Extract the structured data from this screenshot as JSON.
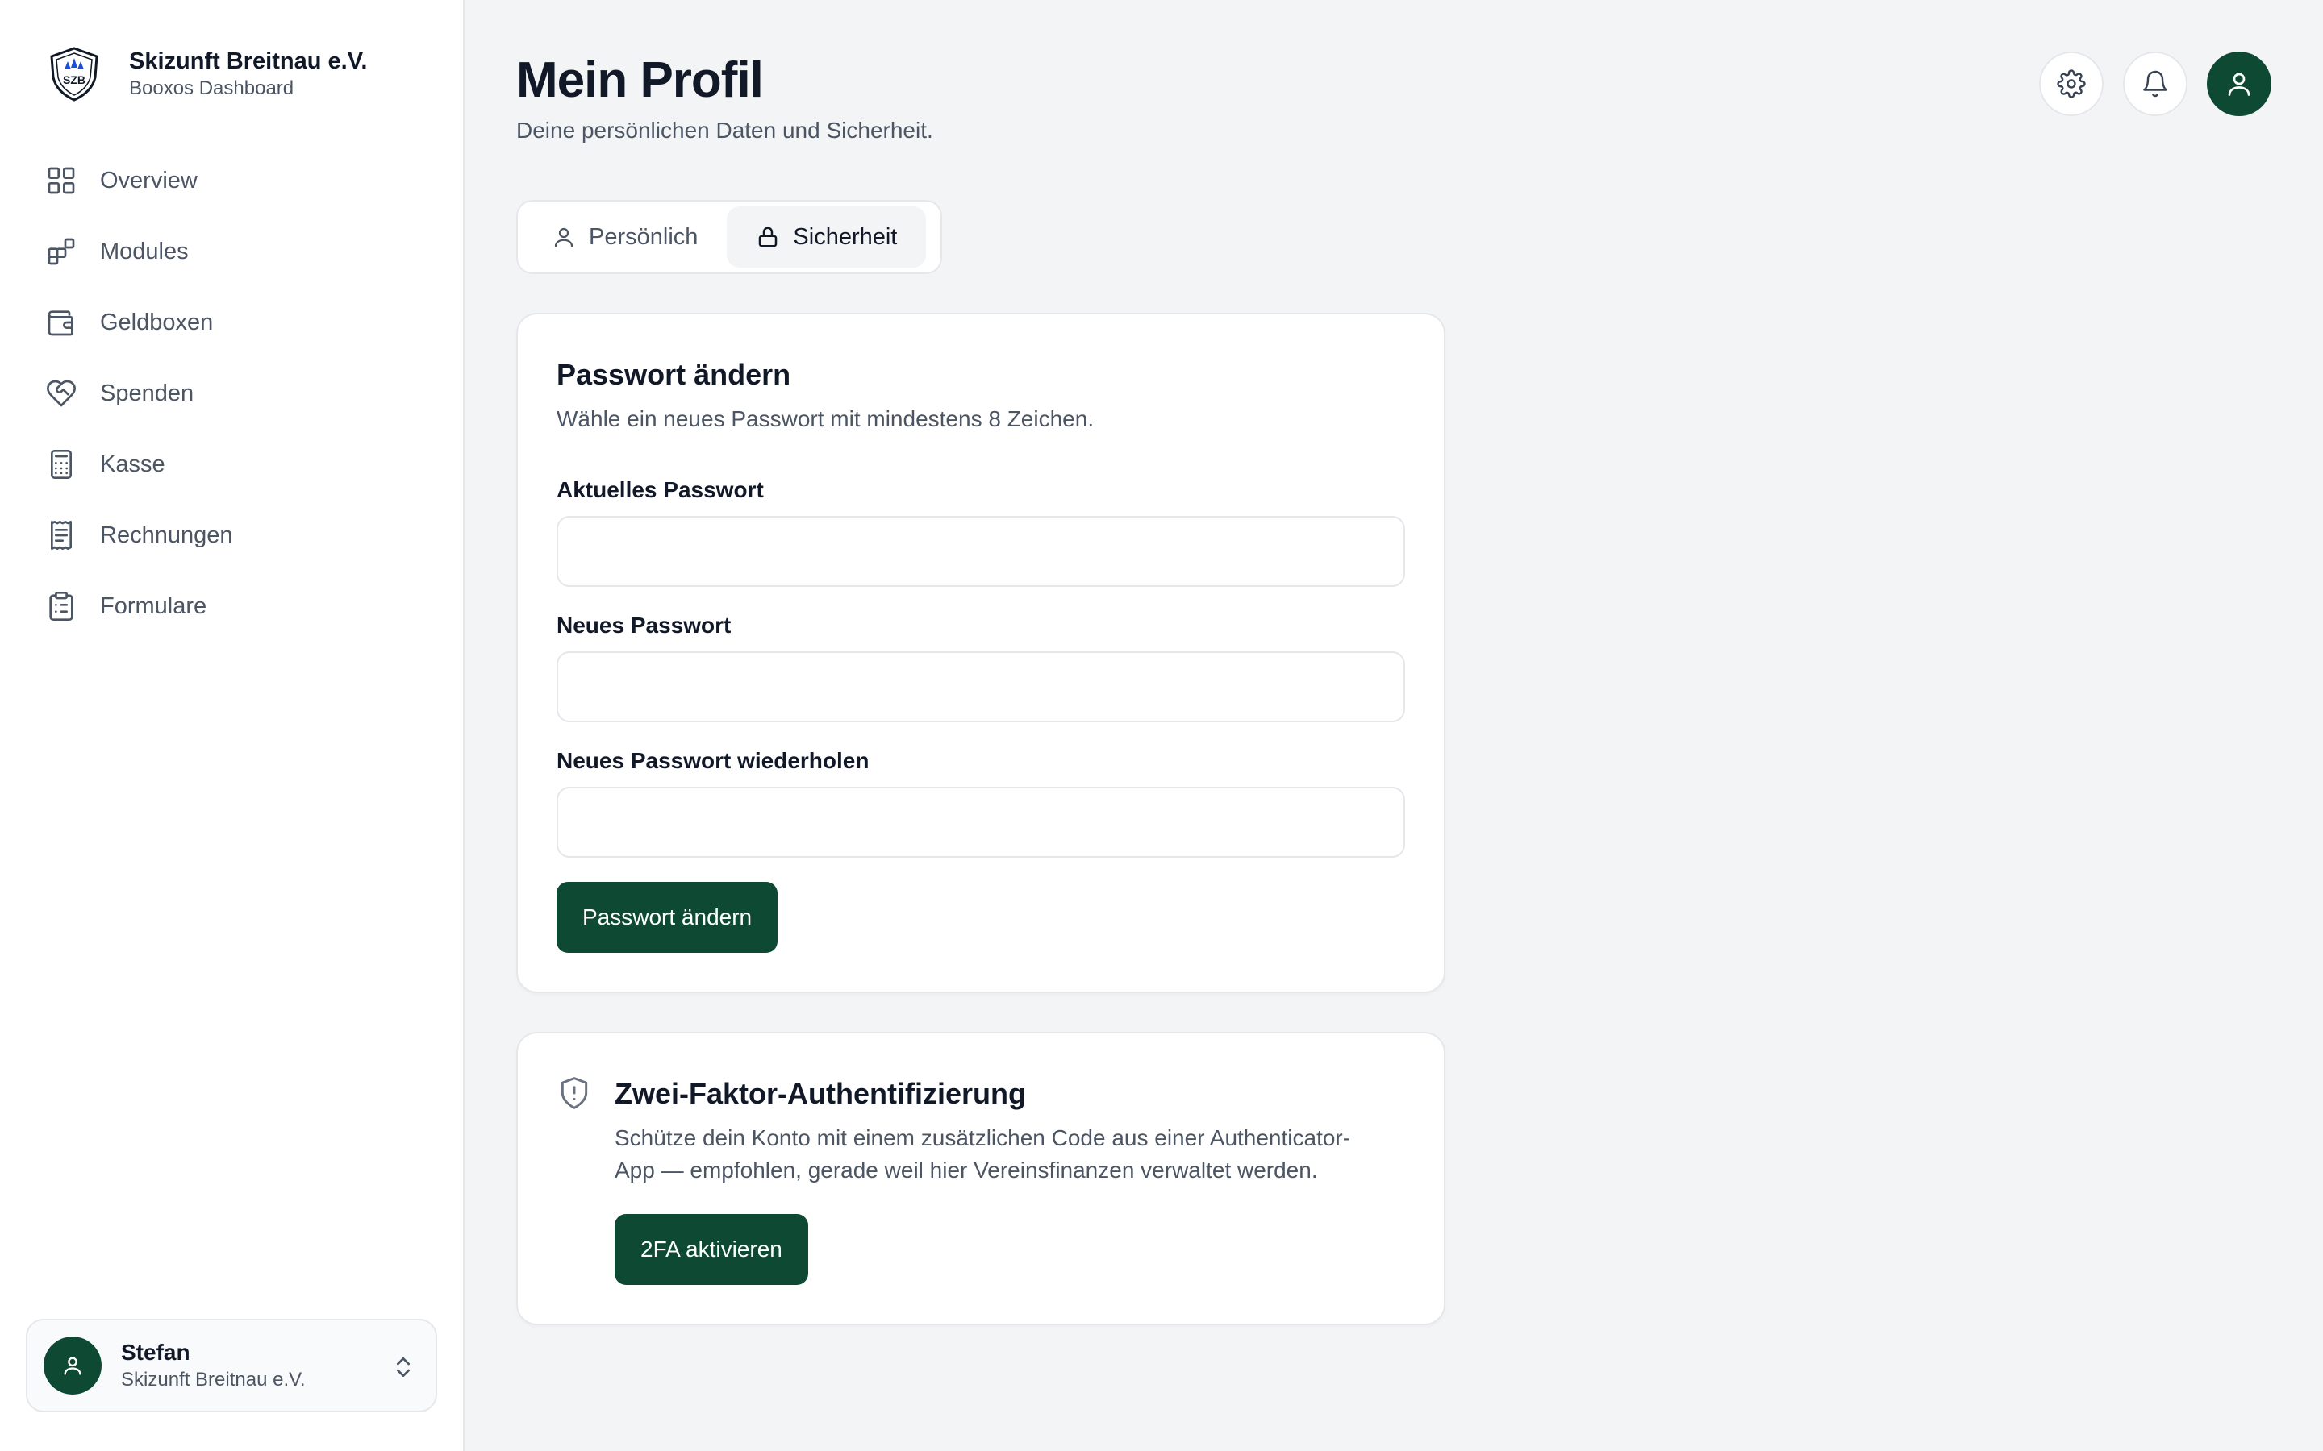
{
  "brand": {
    "title": "Skizunft Breitnau e.V.",
    "subtitle": "Booxos Dashboard",
    "logo_text": "SZB"
  },
  "sidebar": {
    "items": [
      {
        "label": "Overview",
        "icon": "grid-icon"
      },
      {
        "label": "Modules",
        "icon": "modules-icon"
      },
      {
        "label": "Geldboxen",
        "icon": "wallet-icon"
      },
      {
        "label": "Spenden",
        "icon": "heart-handshake-icon"
      },
      {
        "label": "Kasse",
        "icon": "calculator-icon"
      },
      {
        "label": "Rechnungen",
        "icon": "receipt-icon"
      },
      {
        "label": "Formulare",
        "icon": "clipboard-icon"
      }
    ]
  },
  "user": {
    "name": "Stefan",
    "org": "Skizunft Breitnau e.V."
  },
  "header": {
    "title": "Mein Profil",
    "subtitle": "Deine persönlichen Daten und Sicherheit."
  },
  "tabs": [
    {
      "label": "Persönlich",
      "icon": "user-icon",
      "active": false
    },
    {
      "label": "Sicherheit",
      "icon": "lock-icon",
      "active": true
    }
  ],
  "password_card": {
    "title": "Passwort ändern",
    "description": "Wähle ein neues Passwort mit mindestens 8 Zeichen.",
    "fields": [
      {
        "label": "Aktuelles Passwort",
        "value": "",
        "placeholder": ""
      },
      {
        "label": "Neues Passwort",
        "value": "",
        "placeholder": ""
      },
      {
        "label": "Neues Passwort wiederholen",
        "value": "",
        "placeholder": ""
      }
    ],
    "submit_label": "Passwort ändern"
  },
  "twofa_card": {
    "title": "Zwei-Faktor-Authentifizierung",
    "description_line1": "Schütze dein Konto mit einem zusätzlichen Code aus einer Authenticator-",
    "description_line2": "App — empfohlen, gerade weil hier Vereinsfinanzen verwaltet werden.",
    "button_label": "2FA aktivieren"
  },
  "colors": {
    "primary": "#0e4a33",
    "background": "#f3f4f6",
    "border": "#e5e7eb",
    "muted_text": "#4b5563"
  }
}
